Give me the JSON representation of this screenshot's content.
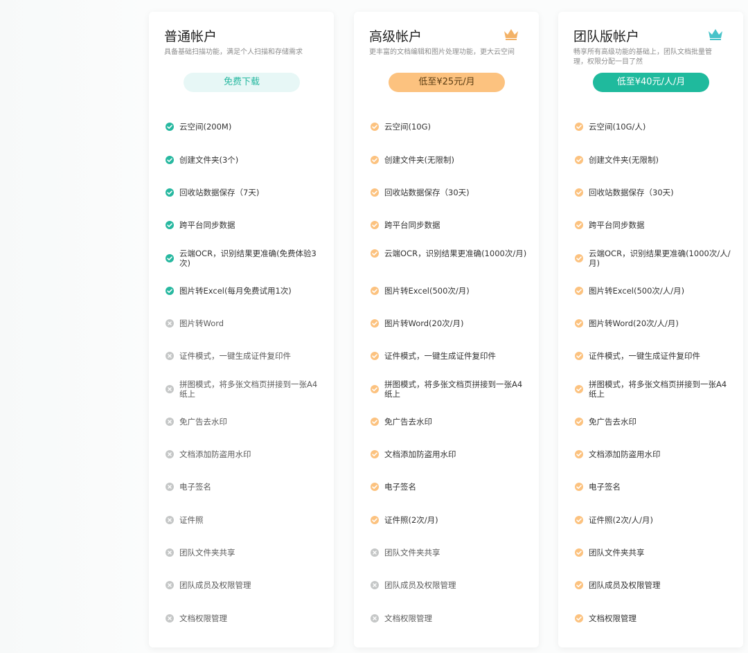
{
  "colors": {
    "accent_basic": "#27b8a0",
    "accent_premium": "#fcc27f",
    "accent_team": "#1fba9d",
    "disabled_icon": "#c5c7c7",
    "crown_premium": "#f3b267",
    "crown_team": "#47c3c9"
  },
  "plans": [
    {
      "id": "basic",
      "title": "普通帐户",
      "description": "具备基础扫描功能，满足个人扫描和存储需求",
      "cta": "免费下载",
      "has_crown": false,
      "features": [
        {
          "text": "云空间(200M)",
          "enabled": true
        },
        {
          "text": "创建文件夹(3个)",
          "enabled": true
        },
        {
          "text": "回收站数据保存（7天)",
          "enabled": true
        },
        {
          "text": "跨平台同步数据",
          "enabled": true
        },
        {
          "text": "云端OCR，识别结果更准确(免费体验3次)",
          "enabled": true
        },
        {
          "text": "图片转Excel(每月免费试用1次)",
          "enabled": true
        },
        {
          "text": "图片转Word",
          "enabled": false
        },
        {
          "text": "证件模式，一键生成证件复印件",
          "enabled": false
        },
        {
          "text": "拼图模式，将多张文档页拼接到一张A4纸上",
          "enabled": false
        },
        {
          "text": "免广告去水印",
          "enabled": false
        },
        {
          "text": "文档添加防盗用水印",
          "enabled": false
        },
        {
          "text": "电子签名",
          "enabled": false
        },
        {
          "text": "证件照",
          "enabled": false
        },
        {
          "text": "团队文件夹共享",
          "enabled": false
        },
        {
          "text": "团队成员及权限管理",
          "enabled": false
        },
        {
          "text": "文档权限管理",
          "enabled": false
        }
      ]
    },
    {
      "id": "premium",
      "title": "高级帐户",
      "description": "更丰富的文档编辑和图片处理功能，更大云空间",
      "cta": "低至¥25元/月",
      "has_crown": true,
      "features": [
        {
          "text": "云空间(10G)",
          "enabled": true
        },
        {
          "text": "创建文件夹(无限制)",
          "enabled": true
        },
        {
          "text": "回收站数据保存（30天)",
          "enabled": true
        },
        {
          "text": "跨平台同步数据",
          "enabled": true
        },
        {
          "text": "云端OCR，识别结果更准确(1000次/月)",
          "enabled": true
        },
        {
          "text": "图片转Excel(500次/月)",
          "enabled": true
        },
        {
          "text": "图片转Word(20次/月)",
          "enabled": true
        },
        {
          "text": "证件模式，一键生成证件复印件",
          "enabled": true
        },
        {
          "text": "拼图模式，将多张文档页拼接到一张A4纸上",
          "enabled": true
        },
        {
          "text": "免广告去水印",
          "enabled": true
        },
        {
          "text": "文档添加防盗用水印",
          "enabled": true
        },
        {
          "text": "电子签名",
          "enabled": true
        },
        {
          "text": "证件照(2次/月)",
          "enabled": true
        },
        {
          "text": "团队文件夹共享",
          "enabled": false
        },
        {
          "text": "团队成员及权限管理",
          "enabled": false
        },
        {
          "text": "文档权限管理",
          "enabled": false
        }
      ]
    },
    {
      "id": "team",
      "title": "团队版帐户",
      "description": "畅享所有高级功能的基础上，团队文档批量管理，权限分配一目了然",
      "cta": "低至¥40元/人/月",
      "has_crown": true,
      "features": [
        {
          "text": "云空间(10G/人)",
          "enabled": true
        },
        {
          "text": "创建文件夹(无限制)",
          "enabled": true
        },
        {
          "text": "回收站数据保存（30天)",
          "enabled": true
        },
        {
          "text": "跨平台同步数据",
          "enabled": true
        },
        {
          "text": "云端OCR，识别结果更准确(1000次/人/月)",
          "enabled": true
        },
        {
          "text": "图片转Excel(500次/人/月)",
          "enabled": true
        },
        {
          "text": "图片转Word(20次/人/月)",
          "enabled": true
        },
        {
          "text": "证件模式，一键生成证件复印件",
          "enabled": true
        },
        {
          "text": "拼图模式，将多张文档页拼接到一张A4纸上",
          "enabled": true
        },
        {
          "text": "免广告去水印",
          "enabled": true
        },
        {
          "text": "文档添加防盗用水印",
          "enabled": true
        },
        {
          "text": "电子签名",
          "enabled": true
        },
        {
          "text": "证件照(2次/人/月)",
          "enabled": true
        },
        {
          "text": "团队文件夹共享",
          "enabled": true
        },
        {
          "text": "团队成员及权限管理",
          "enabled": true
        },
        {
          "text": "文档权限管理",
          "enabled": true
        }
      ]
    }
  ]
}
